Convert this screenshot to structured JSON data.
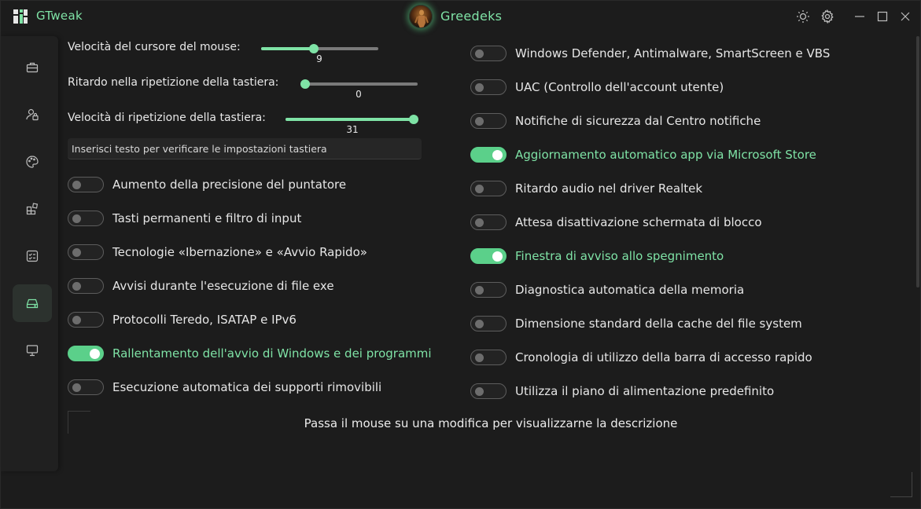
{
  "app": {
    "title": "GTweak",
    "user_name": "Greedeks"
  },
  "sidebar": {
    "items": [
      {
        "icon": "briefcase-icon",
        "active": false
      },
      {
        "icon": "user-lock-icon",
        "active": false
      },
      {
        "icon": "palette-icon",
        "active": false
      },
      {
        "icon": "apps-icon",
        "active": false
      },
      {
        "icon": "checklist-icon",
        "active": false
      },
      {
        "icon": "drive-icon",
        "active": true
      },
      {
        "icon": "monitor-icon",
        "active": false
      }
    ]
  },
  "sliders": [
    {
      "label": "Velocità del cursore del mouse:",
      "value": "9",
      "fraction": 0.45
    },
    {
      "label": "Ritardo nella ripetizione della tastiera:",
      "value": "0",
      "fraction": 0.0
    },
    {
      "label": "Velocità di ripetizione della tastiera:",
      "value": "31",
      "fraction": 1.0
    }
  ],
  "keyboard_test": {
    "placeholder": "Inserisci testo per verificare le impostazioni tastiera"
  },
  "left_toggles": [
    {
      "label": "Aumento della precisione del puntatore",
      "on": false
    },
    {
      "label": "Tasti permanenti e filtro di input",
      "on": false
    },
    {
      "label": "Tecnologie «Ibernazione» e «Avvio Rapido»",
      "on": false
    },
    {
      "label": "Avvisi durante l'esecuzione di file exe",
      "on": false
    },
    {
      "label": "Protocolli Teredo, ISATAP e IPv6",
      "on": false
    },
    {
      "label": "Rallentamento dell'avvio di Windows e dei programmi",
      "on": true
    },
    {
      "label": "Esecuzione automatica dei supporti rimovibili",
      "on": false
    }
  ],
  "right_toggles": [
    {
      "label": "Windows Defender, Antimalware, SmartScreen e VBS",
      "on": false
    },
    {
      "label": "UAC (Controllo dell'account utente)",
      "on": false
    },
    {
      "label": "Notifiche di sicurezza dal Centro notifiche",
      "on": false
    },
    {
      "label": "Aggiornamento automatico app via Microsoft Store",
      "on": true
    },
    {
      "label": "Ritardo audio nel driver Realtek",
      "on": false
    },
    {
      "label": "Attesa disattivazione schermata di blocco",
      "on": false
    },
    {
      "label": "Finestra di avviso allo spegnimento",
      "on": true
    },
    {
      "label": "Diagnostica automatica della memoria",
      "on": false
    },
    {
      "label": "Dimensione standard della cache del file system",
      "on": false
    },
    {
      "label": "Cronologia di utilizzo della barra di accesso rapido",
      "on": false
    },
    {
      "label": "Utilizza il piano di alimentazione predefinito",
      "on": false
    }
  ],
  "description": {
    "text": "Passa il mouse su una modifica per visualizzarne la descrizione"
  },
  "colors": {
    "accent": "#7fe3a6",
    "toggle_on": "#5bd08a",
    "background": "#1c1c1c"
  }
}
